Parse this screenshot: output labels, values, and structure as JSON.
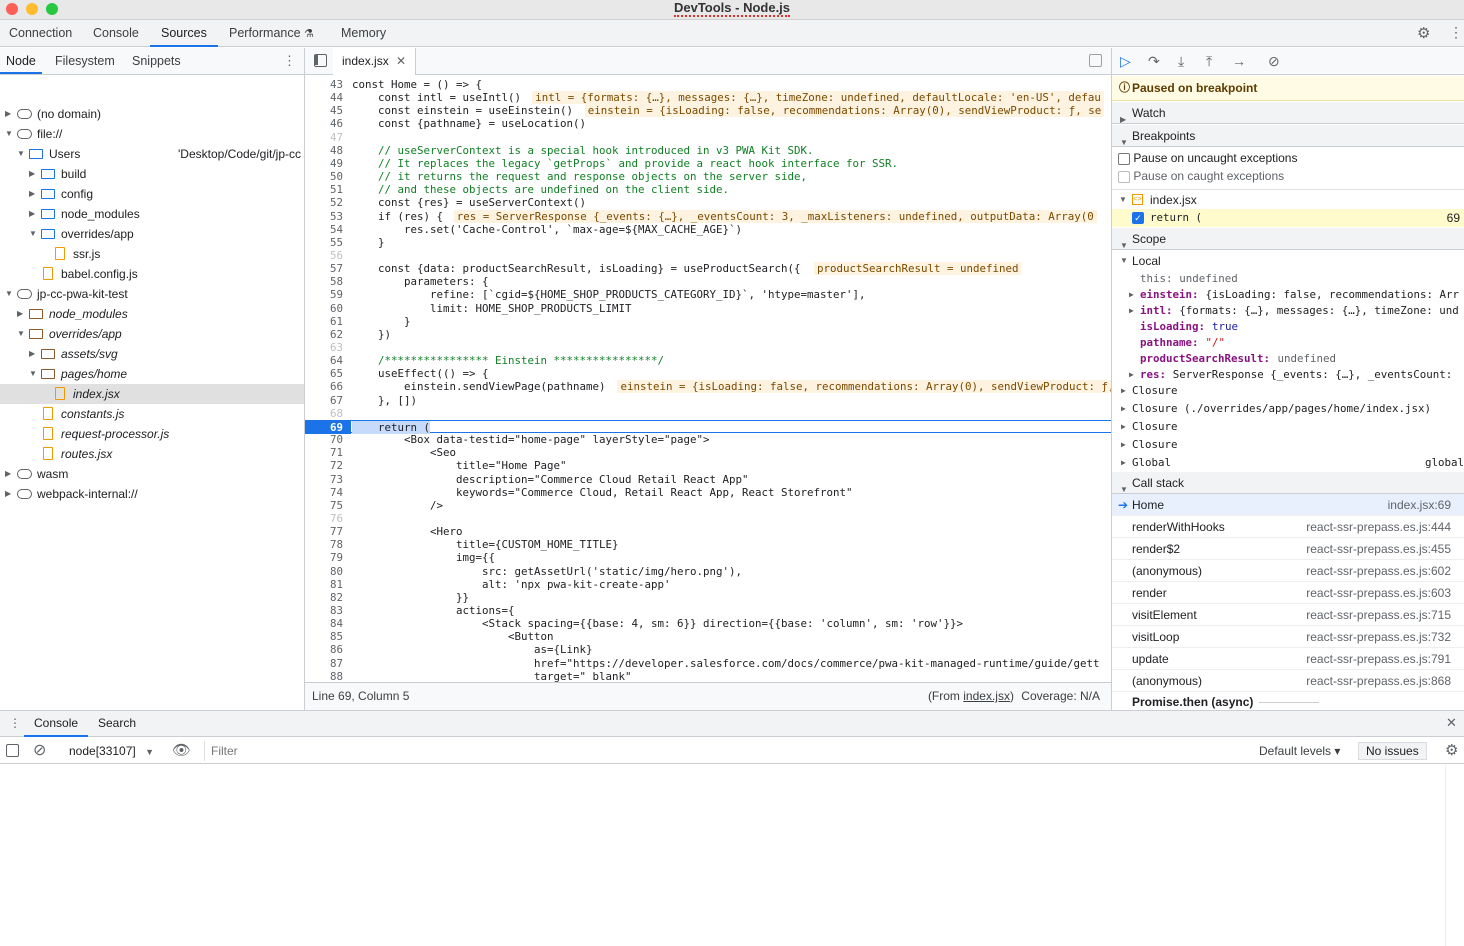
{
  "window": {
    "title": "DevTools - Node.js"
  },
  "main_tabs": [
    "Connection",
    "Console",
    "Sources",
    "Performance",
    "Memory"
  ],
  "navigator": {
    "tabs": [
      "Node",
      "Filesystem",
      "Snippets"
    ],
    "items": [
      {
        "label": "(no domain)"
      },
      {
        "label": "file://"
      },
      {
        "label": "Users",
        "suffix": "'Desktop/Code/git/jp-cc"
      },
      {
        "label": "build"
      },
      {
        "label": "config"
      },
      {
        "label": "node_modules"
      },
      {
        "label": "overrides/app"
      },
      {
        "label": "ssr.js"
      },
      {
        "label": "babel.config.js"
      },
      {
        "label": "jp-cc-pwa-kit-test"
      },
      {
        "label": "node_modules"
      },
      {
        "label": "overrides/app"
      },
      {
        "label": "assets/svg"
      },
      {
        "label": "pages/home"
      },
      {
        "label": "index.jsx"
      },
      {
        "label": "constants.js"
      },
      {
        "label": "request-processor.js"
      },
      {
        "label": "routes.jsx"
      },
      {
        "label": "wasm"
      },
      {
        "label": "webpack-internal://"
      }
    ]
  },
  "editor": {
    "tab": "index.jsx",
    "breakpoint_line": "69",
    "status": {
      "position": "Line 69, Column 5",
      "from_prefix": "(From ",
      "from_file": "index.jsx",
      "from_suffix": ")",
      "coverage": "Coverage: N/A"
    },
    "lines": [
      {
        "n": "43",
        "t": "const Home = () => {"
      },
      {
        "n": "44",
        "t": "    const intl = useIntl()",
        "h": "intl = {formats: {…}, messages: {…}, timeZone: undefined, defaultLocale: 'en-US', defau"
      },
      {
        "n": "45",
        "t": "    const einstein = useEinstein()",
        "h": "einstein = {isLoading: false, recommendations: Array(0), sendViewProduct: ƒ, se"
      },
      {
        "n": "46",
        "t": "    const {pathname} = useLocation()"
      },
      {
        "n": "47",
        "t": ""
      },
      {
        "n": "48",
        "t": "    // useServerContext is a special hook introduced in v3 PWA Kit SDK."
      },
      {
        "n": "49",
        "t": "    // It replaces the legacy `getProps` and provide a react hook interface for SSR."
      },
      {
        "n": "50",
        "t": "    // it returns the request and response objects on the server side,"
      },
      {
        "n": "51",
        "t": "    // and these objects are undefined on the client side."
      },
      {
        "n": "52",
        "t": "    const {res} = useServerContext()"
      },
      {
        "n": "53",
        "t": "    if (res) {",
        "h": "res = ServerResponse {_events: {…}, _eventsCount: 3, _maxListeners: undefined, outputData: Array(0"
      },
      {
        "n": "54",
        "t": "        res.set('Cache-Control', `max-age=${MAX_CACHE_AGE}`)"
      },
      {
        "n": "55",
        "t": "    }"
      },
      {
        "n": "56",
        "t": ""
      },
      {
        "n": "57",
        "t": "    const {data: productSearchResult, isLoading} = useProductSearch({",
        "h": "productSearchResult = undefined"
      },
      {
        "n": "58",
        "t": "        parameters: {"
      },
      {
        "n": "59",
        "t": "            refine: [`cgid=${HOME_SHOP_PRODUCTS_CATEGORY_ID}`, 'htype=master'],"
      },
      {
        "n": "60",
        "t": "            limit: HOME_SHOP_PRODUCTS_LIMIT"
      },
      {
        "n": "61",
        "t": "        }"
      },
      {
        "n": "62",
        "t": "    })"
      },
      {
        "n": "63",
        "t": ""
      },
      {
        "n": "64",
        "t": "    /**************** Einstein ****************/"
      },
      {
        "n": "65",
        "t": "    useEffect(() => {"
      },
      {
        "n": "66",
        "t": "        einstein.sendViewPage(pathname)",
        "h": "einstein = {isLoading: false, recommendations: Array(0), sendViewProduct: ƒ,"
      },
      {
        "n": "67",
        "t": "    }, [])"
      },
      {
        "n": "68",
        "t": ""
      },
      {
        "n": "69",
        "t": "    return ("
      },
      {
        "n": "70",
        "t": "        <Box data-testid=\"home-page\" layerStyle=\"page\">"
      },
      {
        "n": "71",
        "t": "            <Seo"
      },
      {
        "n": "72",
        "t": "                title=\"Home Page\""
      },
      {
        "n": "73",
        "t": "                description=\"Commerce Cloud Retail React App\""
      },
      {
        "n": "74",
        "t": "                keywords=\"Commerce Cloud, Retail React App, React Storefront\""
      },
      {
        "n": "75",
        "t": "            />"
      },
      {
        "n": "76",
        "t": ""
      },
      {
        "n": "77",
        "t": "            <Hero"
      },
      {
        "n": "78",
        "t": "                title={CUSTOM_HOME_TITLE}"
      },
      {
        "n": "79",
        "t": "                img={{"
      },
      {
        "n": "80",
        "t": "                    src: getAssetUrl('static/img/hero.png'),"
      },
      {
        "n": "81",
        "t": "                    alt: 'npx pwa-kit-create-app'"
      },
      {
        "n": "82",
        "t": "                }}"
      },
      {
        "n": "83",
        "t": "                actions={"
      },
      {
        "n": "84",
        "t": "                    <Stack spacing={{base: 4, sm: 6}} direction={{base: 'column', sm: 'row'}}>"
      },
      {
        "n": "85",
        "t": "                        <Button"
      },
      {
        "n": "86",
        "t": "                            as={Link}"
      },
      {
        "n": "87",
        "t": "                            href=\"https://developer.salesforce.com/docs/commerce/pwa-kit-managed-runtime/guide/gett"
      },
      {
        "n": "88",
        "t": "                            target=\"_blank\""
      }
    ]
  },
  "debugger": {
    "paused": "Paused on breakpoint",
    "watch": "Watch",
    "breakpoints": "Breakpoints",
    "pause_uncaught": "Pause on uncaught exceptions",
    "pause_caught": "Pause on caught exceptions",
    "bp_file": "index.jsx",
    "bp_code": "return (",
    "bp_line": "69",
    "scope": "Scope",
    "local": "Local",
    "scope_rows": [
      {
        "k": "this",
        "v": "undefined"
      },
      {
        "k": "einstein",
        "v": "{isLoading: false, recommendations: Arr"
      },
      {
        "k": "intl",
        "v": "{formats: {…}, messages: {…}, timeZone: und"
      },
      {
        "k": "isLoading",
        "v": "true"
      },
      {
        "k": "pathname",
        "v": "\"/\""
      },
      {
        "k": "productSearchResult",
        "v": "undefined"
      },
      {
        "k": "res",
        "v": "ServerResponse {_events: {…}, _eventsCount:"
      }
    ],
    "closures": [
      "Closure",
      "Closure (./overrides/app/pages/home/index.jsx)",
      "Closure",
      "Closure"
    ],
    "global": "Global",
    "global_value": "global",
    "call_stack": "Call stack",
    "frames": [
      {
        "fn": "Home",
        "loc": "index.jsx:69"
      },
      {
        "fn": "renderWithHooks",
        "loc": "react-ssr-prepass.es.js:444"
      },
      {
        "fn": "render$2",
        "loc": "react-ssr-prepass.es.js:455"
      },
      {
        "fn": "(anonymous)",
        "loc": "react-ssr-prepass.es.js:602"
      },
      {
        "fn": "render",
        "loc": "react-ssr-prepass.es.js:603"
      },
      {
        "fn": "visitElement",
        "loc": "react-ssr-prepass.es.js:715"
      },
      {
        "fn": "visitLoop",
        "loc": "react-ssr-prepass.es.js:732"
      },
      {
        "fn": "update",
        "loc": "react-ssr-prepass.es.js:791"
      },
      {
        "fn": "(anonymous)",
        "loc": "react-ssr-prepass.es.js:868"
      }
    ],
    "async": "Promise.then (async)"
  },
  "drawer": {
    "tabs": [
      "Console",
      "Search"
    ],
    "context": "node[33107]",
    "filter_placeholder": "Filter",
    "levels": "Default levels ▾",
    "issues": "No issues"
  }
}
